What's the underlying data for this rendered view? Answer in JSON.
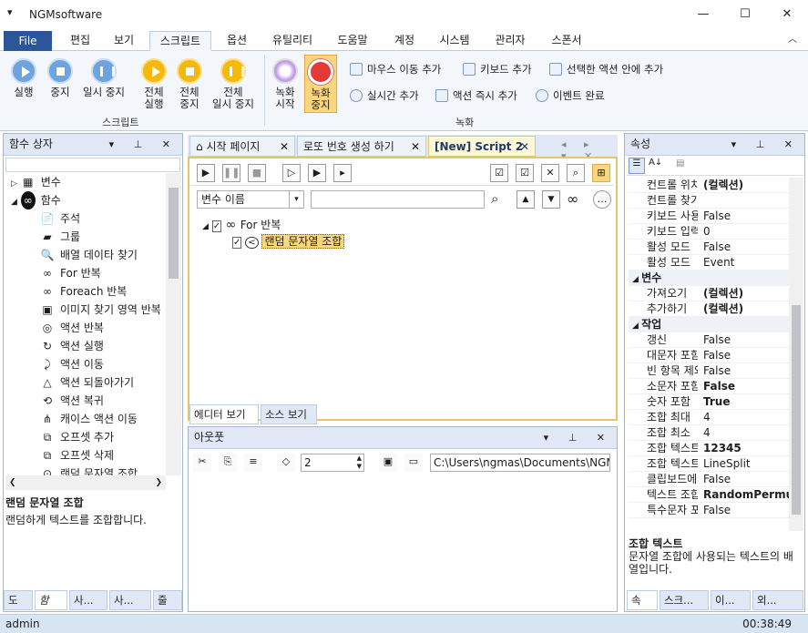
{
  "window": {
    "title": "NGMsoftware",
    "system_menu": "▾",
    "min": "—",
    "max": "☐",
    "close": "✕"
  },
  "menu": {
    "file": "File",
    "tabs": [
      "편집",
      "보기",
      "스크립트",
      "옵션",
      "유틸리티",
      "도움말",
      "계정",
      "시스템",
      "관리자",
      "스폰서"
    ],
    "collapse": "︿"
  },
  "ribbon": {
    "script_group": "스크립트",
    "record_group": "녹화",
    "btn_run": "실행",
    "btn_stop": "중지",
    "btn_pause": "일시 중지",
    "btn_run_all_1": "전체",
    "btn_run_all_2": "실행",
    "btn_stop_all_1": "전체",
    "btn_stop_all_2": "중지",
    "btn_pause_all_1": "전체",
    "btn_pause_all_2": "일시 중지",
    "btn_rec_start_1": "녹화",
    "btn_rec_start_2": "시작",
    "btn_rec_stop_1": "녹화",
    "btn_rec_stop_2": "중지",
    "mouse_move": "마우스 이동 추가",
    "keyboard": "키보드 추가",
    "in_selected": "선택한 액션 안에 추가",
    "realtime": "실시간 추가",
    "immediate": "액션 즉시 추가",
    "event_done": "이벤트 완료"
  },
  "left_panel": {
    "title": "함수 상자",
    "items": [
      {
        "label": "변수",
        "icon": "▦"
      },
      {
        "label": "함수",
        "icon": "∞"
      },
      {
        "label": "주석",
        "icon": "📄"
      },
      {
        "label": "그룹",
        "icon": "▰"
      },
      {
        "label": "배열 데이타 찾기",
        "icon": "🔍"
      },
      {
        "label": "For 반복",
        "icon": "∞"
      },
      {
        "label": "Foreach 반복",
        "icon": "∞"
      },
      {
        "label": "이미지 찾기 영역 반복",
        "icon": "▣"
      },
      {
        "label": "액션 반복",
        "icon": "◎"
      },
      {
        "label": "액션 실행",
        "icon": "↻"
      },
      {
        "label": "액션 이동",
        "icon": "⤸"
      },
      {
        "label": "액션 되돌아가기",
        "icon": "△"
      },
      {
        "label": "액션 복귀",
        "icon": "⟲"
      },
      {
        "label": "캐이스 액션 이동",
        "icon": "⋔"
      },
      {
        "label": "오프셋 추가",
        "icon": "⧉"
      },
      {
        "label": "오프셋 삭제",
        "icon": "⧉"
      },
      {
        "label": "랜덤 문자열 조합",
        "icon": "⊙"
      }
    ],
    "desc_title": "랜덤 문자열 조합",
    "desc_text": "랜덤하게 텍스트를 조합합니다.",
    "bottom_tabs": [
      "도",
      "함",
      "사...",
      "사...",
      "줄"
    ]
  },
  "doc_tabs": [
    {
      "label": "시작 페이지"
    },
    {
      "label": "로또 번호 생성 하기"
    },
    {
      "label": "[New] Script 2"
    }
  ],
  "editor": {
    "search_select": "변수 이름",
    "search_value": "",
    "tree_root": "For 반복",
    "tree_child": "랜덤 문자열 조합",
    "view_tabs": [
      "에디터 보기",
      "소스 보기"
    ]
  },
  "output": {
    "title": "아웃풋",
    "spin_value": "2",
    "path": "C:\\Users\\ngmas\\Documents\\NGM6\\"
  },
  "props": {
    "title": "속성",
    "rows": [
      {
        "n": "컨트롤 위치",
        "v": "(컬렉션)",
        "b": true
      },
      {
        "n": "컨트롤 찾기",
        "v": "",
        "b": false
      },
      {
        "n": "키보드 사용",
        "v": "False",
        "b": false
      },
      {
        "n": "키보드 입력",
        "v": "0",
        "b": false
      },
      {
        "n": "활성 모드",
        "v": "False",
        "b": false
      },
      {
        "n": "활성 모드",
        "v": "Event",
        "b": false
      }
    ],
    "cat_var": "변수",
    "var_rows": [
      {
        "n": "가져오기",
        "v": "(컬렉션)",
        "b": true
      },
      {
        "n": "추가하기",
        "v": "(컬렉션)",
        "b": true
      }
    ],
    "cat_work": "작업",
    "work_rows": [
      {
        "n": "갱신",
        "v": "False",
        "b": false
      },
      {
        "n": "대문자 포함",
        "v": "False",
        "b": false
      },
      {
        "n": "빈 항목 제외",
        "v": "False",
        "b": false
      },
      {
        "n": "소문자 포함",
        "v": "False",
        "b": true
      },
      {
        "n": "숫자 포함",
        "v": "True",
        "b": true
      },
      {
        "n": "조합 최대",
        "v": "4",
        "b": false
      },
      {
        "n": "조합 최소",
        "v": "4",
        "b": false
      },
      {
        "n": "조합 텍스트",
        "v": "12345",
        "b": true
      },
      {
        "n": "조합 텍스트",
        "v": "LineSplit",
        "b": false
      },
      {
        "n": "클립보드에",
        "v": "False",
        "b": false
      },
      {
        "n": "텍스트 조합",
        "v": "RandomPermu",
        "b": true
      },
      {
        "n": "특수문자 포함",
        "v": "False",
        "b": false
      }
    ],
    "desc_title": "조합 텍스트",
    "desc_text": "문자열 조합에 사용되는 텍스트의 배열입니다.",
    "bottom_tabs": [
      "속",
      "스크...",
      "이...",
      "외..."
    ]
  },
  "status": {
    "user": "admin",
    "time": "00:38:49"
  }
}
